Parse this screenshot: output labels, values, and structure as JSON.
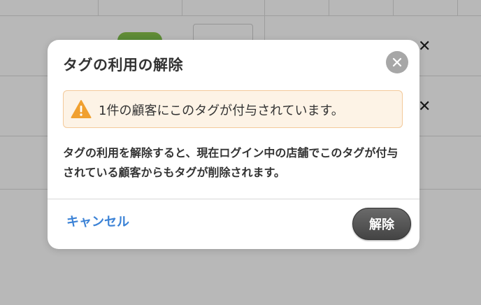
{
  "background": {
    "close_glyph": "✕"
  },
  "modal": {
    "title": "タグの利用の解除",
    "close_icon": "close-icon",
    "warning": {
      "icon": "warning-icon",
      "text": "1件の顧客にこのタグが付与されています。",
      "background_color": "#fdf3e6",
      "border_color": "#f3c99a",
      "icon_color": "#f0a030"
    },
    "description": "タグの利用を解除すると、現在ログイン中の店舗でこのタグが付与されている顧客からもタグが削除されます。",
    "cancel_label": "キャンセル",
    "confirm_label": "解除",
    "accent_color": "#3b82d6"
  }
}
